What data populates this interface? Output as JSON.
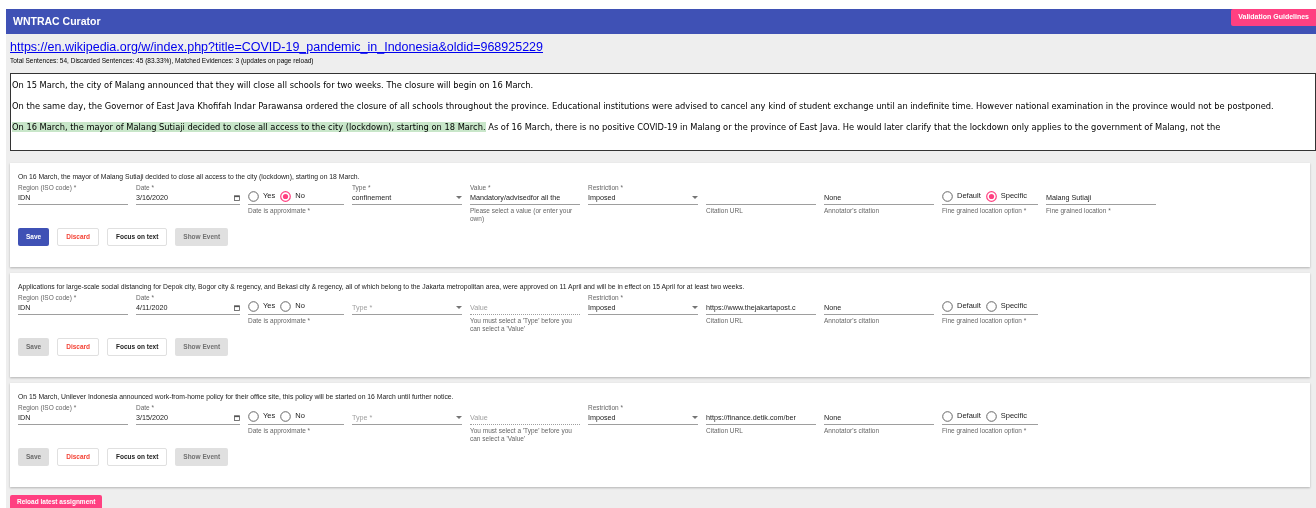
{
  "header": {
    "title": "WNTRAC Curator",
    "button": "Validation Guidelines"
  },
  "source": {
    "url": "https://en.wikipedia.org/w/index.php?title=COVID-19_pandemic_in_Indonesia&oldid=968925229",
    "stats": "Total Sentences: 54, Discarded Sentences: 45 (83.33%), Matched Evidences: 3 (updates on page reload)"
  },
  "article": {
    "paragraphs": [
      {
        "segments": [
          {
            "text": "On 15 March, the city of Malang announced that they will close all schools for two weeks. The closure will begin on 16 March.",
            "highlighted": false
          }
        ]
      },
      {
        "segments": [
          {
            "text": "On the same day, the Governor of East Java Khofifah Indar Parawansa ordered the closure of all schools throughout the province. Educational institutions were advised to cancel any kind of student exchange until an indefinite time. However national examination in the province would not be postponed.",
            "highlighted": false
          }
        ]
      },
      {
        "segments": [
          {
            "text": "On 16 March, the mayor of Malang Sutiaji decided to close all access to the city (lockdown), starting on 18 March.",
            "highlighted": true
          },
          {
            "text": " As of 16 March, there is no positive COVID-19 in Malang or the province of East Java. He would later clarify that the lockdown only applies to the government of Malang, not the",
            "highlighted": false
          }
        ]
      }
    ]
  },
  "cards": [
    {
      "sentence": "On 16 March, the mayor of Malang Sutiaji decided to close all access to the city (lockdown), starting on 18 March.",
      "fields": [
        {
          "kind": "text",
          "label": "Region (ISO code) *",
          "value": "IDN"
        },
        {
          "kind": "date",
          "label": "Date *",
          "value": "3/16/2020"
        },
        {
          "kind": "radio",
          "options": [
            {
              "label": "Yes",
              "selected": false
            },
            {
              "label": "No",
              "selected": true
            }
          ],
          "helper": "Date is approximate *"
        },
        {
          "kind": "select",
          "label": "Type *",
          "value": "confinement"
        },
        {
          "kind": "text",
          "label": "Value *",
          "value": "Mandatory/advisedfor all the",
          "helper": "Please select a value (or enter your own)"
        },
        {
          "kind": "select",
          "label": "Restriction *",
          "value": "Imposed"
        },
        {
          "kind": "text",
          "helper": "Citation URL"
        },
        {
          "kind": "text",
          "value": "None",
          "helper": "Annotator's citation"
        },
        {
          "kind": "radio",
          "options": [
            {
              "label": "Default",
              "selected": false
            },
            {
              "label": "Specific",
              "selected": true
            }
          ],
          "helper": "Fine grained location option *"
        },
        {
          "kind": "text",
          "value": "Malang Sutiaji",
          "helper": "Fine grained location *"
        }
      ],
      "buttons": [
        {
          "label": "Save",
          "kind": "primary",
          "disabled": false
        },
        {
          "label": "Discard",
          "kind": "danger",
          "disabled": false
        },
        {
          "label": "Focus on text",
          "kind": "plain",
          "disabled": false
        },
        {
          "label": "Show Event",
          "kind": "plain",
          "disabled": true
        }
      ]
    },
    {
      "sentence": "Applications for large-scale social distancing for Depok city, Bogor city & regency, and Bekasi city & regency, all of which belong to the Jakarta metropolitan area, were approved on 11 April and will be in effect on 15 April for at least two weeks.",
      "fields": [
        {
          "kind": "text",
          "label": "Region (ISO code) *",
          "value": "IDN"
        },
        {
          "kind": "date",
          "label": "Date *",
          "value": "4/11/2020"
        },
        {
          "kind": "radio",
          "options": [
            {
              "label": "Yes",
              "selected": false
            },
            {
              "label": "No",
              "selected": false
            }
          ],
          "helper": "Date is approximate *"
        },
        {
          "kind": "select",
          "placeholder": "Type *"
        },
        {
          "kind": "text",
          "placeholder": "Value",
          "helper": "You must select a 'Type' before you can select a 'Value'",
          "disabled": true
        },
        {
          "kind": "select",
          "label": "Restriction *",
          "value": "Imposed"
        },
        {
          "kind": "text",
          "value": "https://www.thejakartapost.c",
          "helper": "Citation URL"
        },
        {
          "kind": "text",
          "value": "None",
          "helper": "Annotator's citation"
        },
        {
          "kind": "radio",
          "options": [
            {
              "label": "Default",
              "selected": false
            },
            {
              "label": "Specific",
              "selected": false
            }
          ],
          "helper": "Fine grained location option *"
        }
      ],
      "buttons": [
        {
          "label": "Save",
          "kind": "primary",
          "disabled": true
        },
        {
          "label": "Discard",
          "kind": "danger",
          "disabled": false
        },
        {
          "label": "Focus on text",
          "kind": "plain",
          "disabled": false
        },
        {
          "label": "Show Event",
          "kind": "plain",
          "disabled": true
        }
      ]
    },
    {
      "sentence": "On 15 March, Unilever Indonesia announced work-from-home policy for their office site, this policy will be started on 16 March until further notice.",
      "fields": [
        {
          "kind": "text",
          "label": "Region (ISO code) *",
          "value": "IDN"
        },
        {
          "kind": "date",
          "label": "Date *",
          "value": "3/15/2020"
        },
        {
          "kind": "radio",
          "options": [
            {
              "label": "Yes",
              "selected": false
            },
            {
              "label": "No",
              "selected": false
            }
          ],
          "helper": "Date is approximate *"
        },
        {
          "kind": "select",
          "placeholder": "Type *"
        },
        {
          "kind": "text",
          "placeholder": "Value",
          "helper": "You must select a 'Type' before you can select a 'Value'",
          "disabled": true
        },
        {
          "kind": "select",
          "label": "Restriction *",
          "value": "Imposed"
        },
        {
          "kind": "text",
          "value": "https://finance.detik.com/ber",
          "helper": "Citation URL"
        },
        {
          "kind": "text",
          "value": "None",
          "helper": "Annotator's citation"
        },
        {
          "kind": "radio",
          "options": [
            {
              "label": "Default",
              "selected": false
            },
            {
              "label": "Specific",
              "selected": false
            }
          ],
          "helper": "Fine grained location option *"
        }
      ],
      "buttons": [
        {
          "label": "Save",
          "kind": "primary",
          "disabled": true
        },
        {
          "label": "Discard",
          "kind": "danger",
          "disabled": false
        },
        {
          "label": "Focus on text",
          "kind": "plain",
          "disabled": false
        },
        {
          "label": "Show Event",
          "kind": "plain",
          "disabled": true
        }
      ]
    }
  ],
  "reload_button": "Reload latest assignment"
}
